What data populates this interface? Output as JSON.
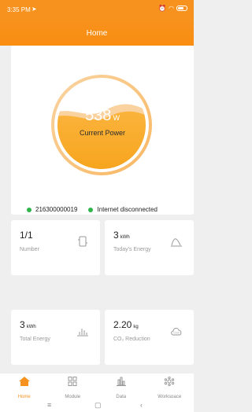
{
  "status_bar": {
    "time": "3:35 PM"
  },
  "header": {
    "title": "Home"
  },
  "power": {
    "value": "538",
    "unit": "W",
    "label": "Current Power"
  },
  "device": {
    "serial": "216300000019",
    "internet_status": "Internet disconnected"
  },
  "stats": [
    {
      "value": "1/1",
      "unit": "",
      "label": "Number",
      "icon": "device-icon"
    },
    {
      "value": "3",
      "unit": "kWh",
      "label": "Today's Energy",
      "icon": "curve-chart-icon"
    },
    {
      "value": "3",
      "unit": "kWh",
      "label": "Total Energy",
      "icon": "bar-chart-icon"
    },
    {
      "value": "2.20",
      "unit": "kg",
      "label": "CO₂ Reduction",
      "icon": "co2-cloud-icon"
    }
  ],
  "tabs": [
    {
      "label": "Home",
      "icon": "home-icon",
      "active": true
    },
    {
      "label": "Module",
      "icon": "grid-icon",
      "active": false
    },
    {
      "label": "Data",
      "icon": "data-chart-icon",
      "active": false
    },
    {
      "label": "Workspace",
      "icon": "workspace-icon",
      "active": false
    }
  ],
  "colors": {
    "accent": "#f7921e",
    "online": "#2eb64c"
  }
}
